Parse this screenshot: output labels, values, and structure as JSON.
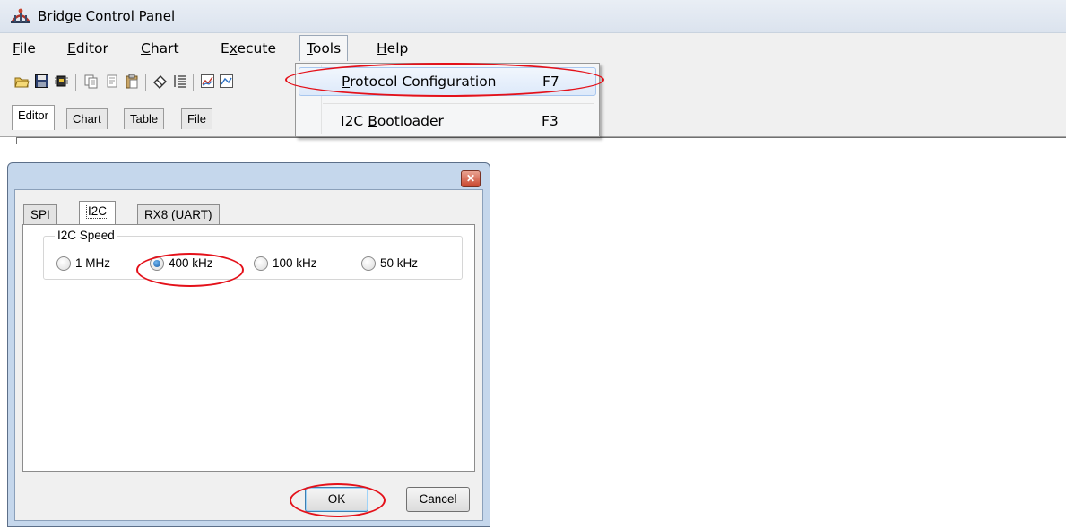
{
  "window": {
    "title": "Bridge Control Panel",
    "icon": "bridge-app-icon"
  },
  "menubar": {
    "items": [
      {
        "label": "File",
        "mnemonic": "F",
        "rest": "ile"
      },
      {
        "label": "Editor",
        "mnemonic": "E",
        "rest": "ditor"
      },
      {
        "label": "Chart",
        "mnemonic": "C",
        "rest": "hart"
      },
      {
        "label": "Execute",
        "pre": "E",
        "mnemonic": "x",
        "rest": "ecute"
      },
      {
        "label": "Tools",
        "mnemonic": "T",
        "rest": "ools"
      },
      {
        "label": "Help",
        "mnemonic": "H",
        "rest": "elp"
      }
    ]
  },
  "toolbar": {
    "icons": [
      "open-folder-icon",
      "save-icon",
      "chip-icon",
      "copy-icon",
      "cut-icon",
      "paste-icon",
      "eraser-icon",
      "list-icon",
      "chart-icon"
    ]
  },
  "tabs": [
    "Editor",
    "Chart",
    "Table",
    "File"
  ],
  "tools_menu": {
    "items": [
      {
        "label": "Protocol Configuration",
        "mnemonic": "P",
        "rest": "rotocol Configuration",
        "shortcut": "F7",
        "highlighted": true
      },
      {
        "label": "I2C Bootloader",
        "pre": "I2C ",
        "mnemonic": "B",
        "rest": "ootloader",
        "shortcut": "F3",
        "highlighted": false
      }
    ]
  },
  "dialog": {
    "close_glyph": "✕",
    "tabs": [
      "SPI",
      "I2C",
      "RX8 (UART)"
    ],
    "active_tab": "I2C",
    "group_title": "I2C Speed",
    "speeds": [
      {
        "label": "1 MHz",
        "selected": false
      },
      {
        "label": "400 kHz",
        "selected": true
      },
      {
        "label": "100 kHz",
        "selected": false
      },
      {
        "label": "50 kHz",
        "selected": false
      }
    ],
    "ok_label": "OK",
    "cancel_label": "Cancel"
  },
  "annotation_color": "#e4111a"
}
